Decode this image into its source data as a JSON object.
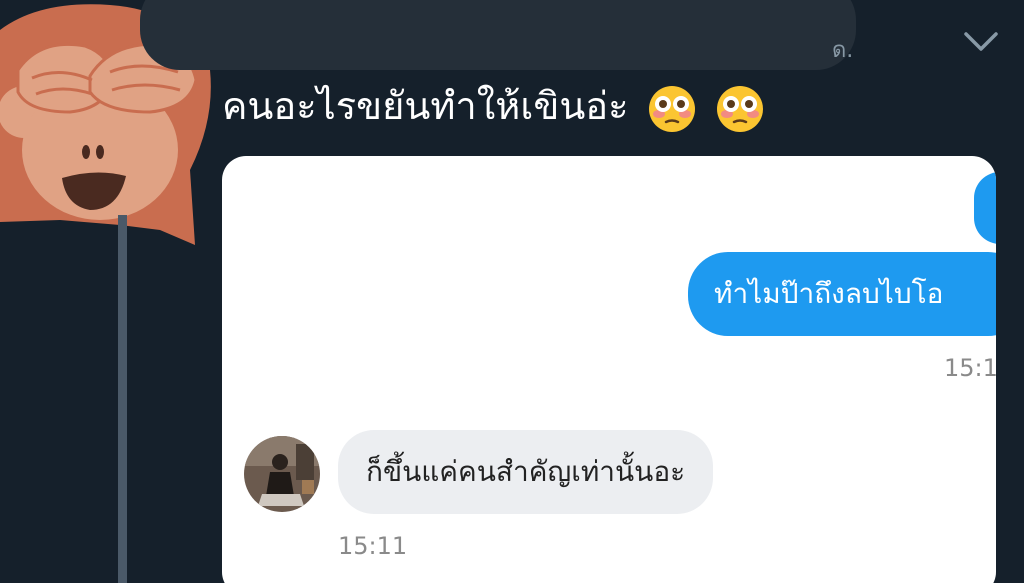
{
  "header": {
    "trail_text": "ด.",
    "caret_icon": "chevron-down-icon"
  },
  "tweet": {
    "text": "คนอะไรขยันทำให้เขินอ่ะ",
    "emojis": [
      "flushed-face-emoji",
      "flushed-face-emoji"
    ]
  },
  "chat": {
    "outgoing_message": "ทำไมป๊าถึงลบไบโอ",
    "outgoing_time": "15:1",
    "incoming_message": "ก็ขึ้นแค่คนสำคัญเท่านั้นอะ",
    "incoming_time": "15:11"
  },
  "colors": {
    "background": "#15202b",
    "outgoing_bubble": "#1e9af0",
    "incoming_bubble": "#eceef1",
    "monkey": "#c96d4f"
  }
}
